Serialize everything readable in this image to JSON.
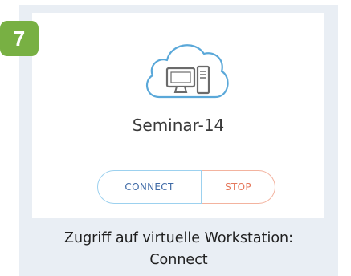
{
  "step": {
    "number": "7",
    "color": "#78b043"
  },
  "workstation": {
    "icon": "cloud-computer-icon",
    "name": "Seminar-14"
  },
  "actions": {
    "connect_label": "CONNECT",
    "stop_label": "STOP",
    "connect_color": "#3f6aa6",
    "stop_color": "#e5785c"
  },
  "caption": {
    "line1": "Zugriff auf virtuelle Workstation:",
    "line2": "Connect"
  }
}
